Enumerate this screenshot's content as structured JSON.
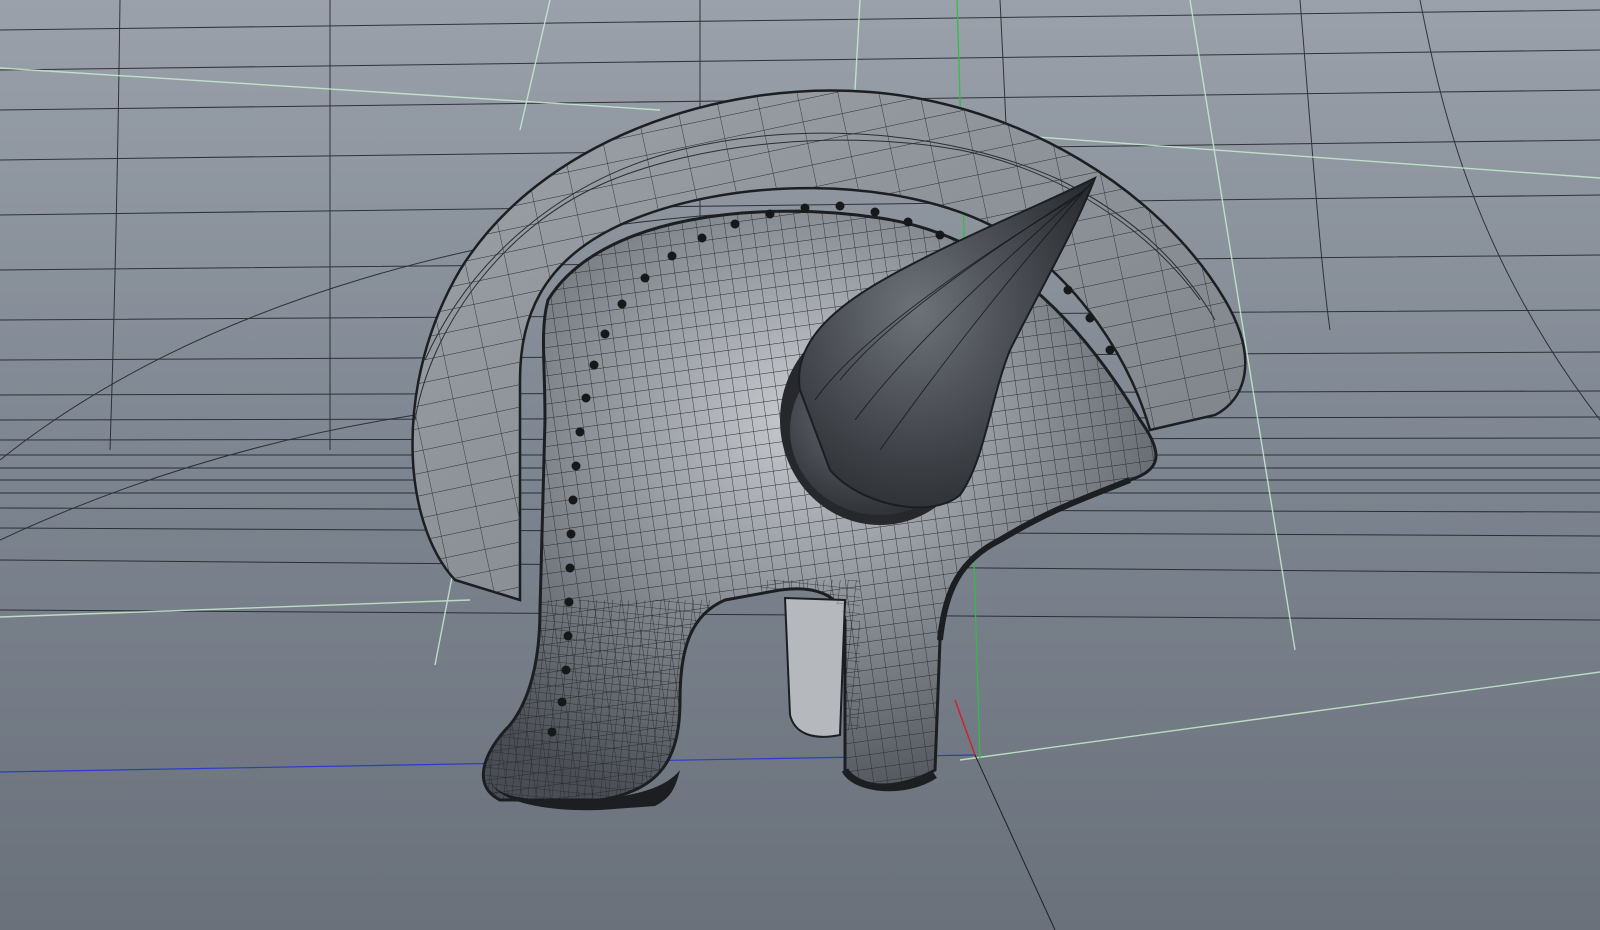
{
  "viewport": {
    "mode": "3d-perspective",
    "display": "wireframe-on-shaded",
    "background_color": "#6f7782",
    "grid_line_color": "#1e2227",
    "guide_line_color": "#c8ecd0"
  },
  "axes": {
    "x_color": "#d0202a",
    "y_color": "#2cc040",
    "z_color": "#2a3cd0"
  },
  "model": {
    "name": "horned-crested-helmet",
    "shell_color": "#8f949b",
    "edge_color": "#2a2d31",
    "rim_color": "#1c1e21",
    "horn_color": "#3a3d42",
    "rivet_color": "#16181a"
  },
  "labels": {}
}
